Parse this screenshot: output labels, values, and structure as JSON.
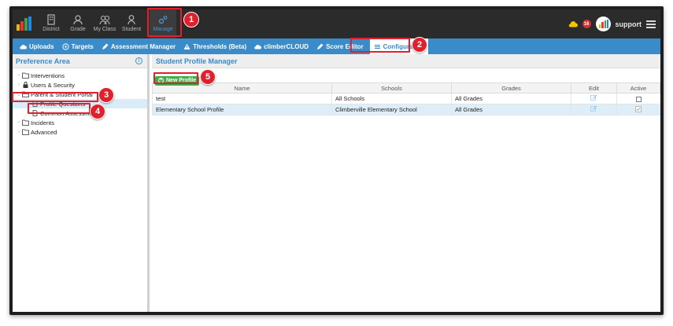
{
  "topnav": {
    "items": [
      {
        "label": "District",
        "icon": "building-icon"
      },
      {
        "label": "Grade",
        "icon": "group-icon"
      },
      {
        "label": "My Class",
        "icon": "class-icon"
      },
      {
        "label": "Student",
        "icon": "person-icon"
      },
      {
        "label": "Manage",
        "icon": "gears-icon"
      }
    ],
    "notification_count": "16",
    "username": "support"
  },
  "subnav": {
    "items": [
      {
        "label": "Uploads",
        "icon": "cloud-upload-icon"
      },
      {
        "label": "Targets",
        "icon": "target-icon"
      },
      {
        "label": "Assessment Manager",
        "icon": "pencil-icon"
      },
      {
        "label": "Thresholds (Beta)",
        "icon": "warning-icon"
      },
      {
        "label": "climberCLOUD",
        "icon": "cloud-icon"
      },
      {
        "label": "Score Editor",
        "icon": "pencil-icon"
      },
      {
        "label": "Configuration",
        "icon": "list-icon"
      }
    ]
  },
  "left": {
    "title": "Preference Area",
    "tree": [
      {
        "label": "Interventions",
        "level": 0,
        "icon": "folder-icon"
      },
      {
        "label": "Users & Security",
        "level": 0,
        "icon": "lock-icon"
      },
      {
        "label": "Parent & Student Portal",
        "level": 0,
        "icon": "folder-open-icon"
      },
      {
        "label": "Profile Questions",
        "level": 1,
        "icon": "document-icon"
      },
      {
        "label": "Common Assessment",
        "level": 1,
        "icon": "document-icon"
      },
      {
        "label": "Incidents",
        "level": 0,
        "icon": "folder-icon"
      },
      {
        "label": "Advanced",
        "level": 0,
        "icon": "folder-icon"
      }
    ]
  },
  "right": {
    "title": "Student Profile Manager",
    "new_button": "New Profile",
    "columns": [
      "Name",
      "Schools",
      "Grades",
      "Edit",
      "Active"
    ],
    "rows": [
      {
        "name": "test",
        "schools": "All Schools",
        "grades": "All Grades",
        "active": false
      },
      {
        "name": "Elementary School Profile",
        "schools": "Climberville Elementary School",
        "grades": "All Grades",
        "active": true
      }
    ]
  },
  "callouts": [
    "1",
    "2",
    "3",
    "4",
    "5"
  ],
  "colors": {
    "accent": "#3a8bc9",
    "callout": "#e0202c",
    "new_button": "#3fae49",
    "topnav": "#2b2b2b"
  }
}
